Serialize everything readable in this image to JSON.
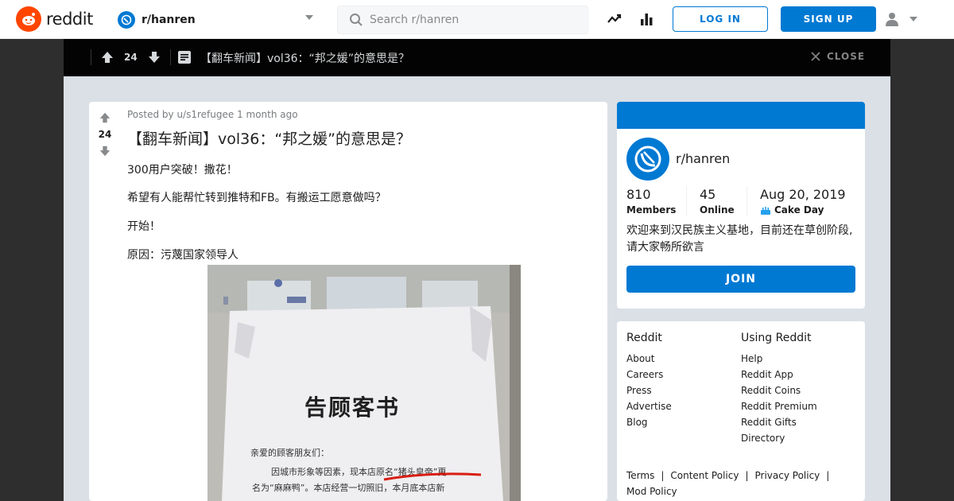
{
  "header": {
    "brand": "reddit",
    "subreddit": "r/hanren",
    "search_placeholder": "Search r/hanren",
    "login_label": "LOG IN",
    "signup_label": "SIGN UP"
  },
  "post_bar": {
    "score": "24",
    "title": "【翻车新闻】vol36：“邦之媛”的意思是？",
    "close_label": "CLOSE"
  },
  "post": {
    "score": "24",
    "meta": "Posted by u/s1refugee 1 month ago",
    "title": "【翻车新闻】vol36：“邦之媛”的意思是？",
    "paragraphs": [
      "300用户突破！撒花！",
      "希望有人能帮忙转到推特和FB。有搬运工愿意做吗？",
      "开始！",
      "原因：污蔑国家领导人"
    ],
    "image": {
      "heading": "告顾客书",
      "line1": "亲爱的顾客朋友们：",
      "line2a": "因城市形象等因素，现本店原名",
      "line2b": "“猪头皇帝”更",
      "line3": "名为“麻麻鸭”。本店经营一切照旧，本月底本店新"
    }
  },
  "sidebar": {
    "name": "r/hanren",
    "members_count": "810",
    "members_label": "Members",
    "online_count": "45",
    "online_label": "Online",
    "cake_date": "Aug 20, 2019",
    "cake_label": "Cake Day",
    "description": "欢迎来到汉民族主义基地，目前还在草创阶段,请大家畅所欲言",
    "join_label": "JOIN"
  },
  "links": {
    "col1_title": "Reddit",
    "col1": [
      "About",
      "Careers",
      "Press",
      "Advertise",
      "Blog"
    ],
    "col2_title": "Using Reddit",
    "col2": [
      "Help",
      "Reddit App",
      "Reddit Coins",
      "Reddit Premium",
      "Reddit Gifts",
      "Directory"
    ],
    "legal": [
      "Terms",
      "Content Policy",
      "Privacy Policy",
      "Mod Policy"
    ]
  },
  "colors": {
    "brand_orange": "#ff4500",
    "accent_blue": "#0079d3",
    "dark_bar": "#030303"
  }
}
